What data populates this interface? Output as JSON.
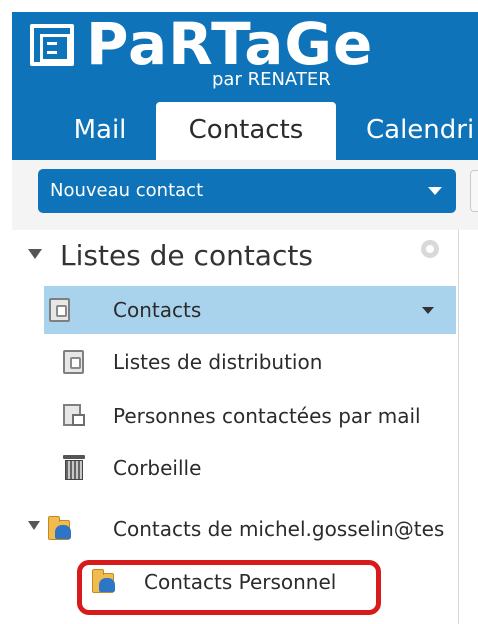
{
  "header": {
    "logo_text": "PaRTaGe",
    "logo_subtext": "par RENATER",
    "tabs": [
      {
        "label": "Mail"
      },
      {
        "label": "Contacts"
      },
      {
        "label": "Calendri"
      }
    ]
  },
  "toolbar": {
    "new_contact_label": "Nouveau contact"
  },
  "tree": {
    "section_title": "Listes de contacts",
    "items": [
      {
        "label": "Contacts"
      },
      {
        "label": "Listes de distribution"
      },
      {
        "label": "Personnes contactées par mail"
      },
      {
        "label": "Corbeille"
      },
      {
        "label": "Contacts de michel.gosselin@tes"
      },
      {
        "label": "Contacts Personnel"
      }
    ]
  },
  "colors": {
    "brand_blue": "#0f73b9",
    "selection_blue": "#a9d3ec",
    "highlight_red": "#d91a1a"
  }
}
